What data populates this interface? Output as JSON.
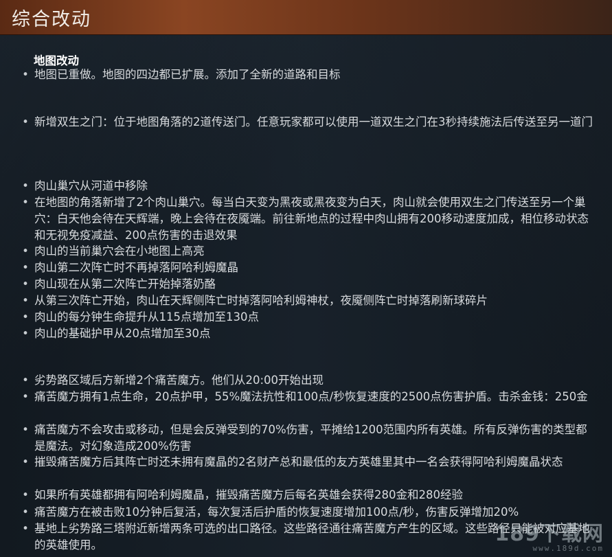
{
  "header": {
    "title": "综合改动"
  },
  "section": {
    "title": "地图改动"
  },
  "bullets": [
    {
      "text": "地图已重做。地图的四边都已扩展。添加了全新的道路和目标"
    },
    {
      "text": "新增双生之门：位于地图角落的2道传送门。任意玩家都可以使用一道双生之门在3秒持续施法后传送至另一道门"
    },
    {
      "text": "肉山巢穴从河道中移除"
    },
    {
      "text": "在地图的角落新增了2个肉山巢穴。每当白天变为黑夜或黑夜变为白天，肉山就会使用双生之门传送至另一个巢穴：白天他会待在天辉端，晚上会待在夜魇端。前往新地点的过程中肉山拥有200移动速度加成，相位移动状态和无视免疫减益、200点伤害的击退效果"
    },
    {
      "text": "肉山的当前巢穴会在小地图上高亮"
    },
    {
      "text": "肉山第二次阵亡时不再掉落阿哈利姆魔晶"
    },
    {
      "text": "肉山现在从第二次阵亡开始掉落奶酪"
    },
    {
      "text": "从第三次阵亡开始，肉山在天辉侧阵亡时掉落阿哈利姆神杖，夜魇侧阵亡时掉落刷新球碎片"
    },
    {
      "text": "肉山的每分钟生命提升从115点增加至130点"
    },
    {
      "text": "肉山的基础护甲从20点增加至30点"
    },
    {
      "text": "劣势路区域后方新增2个痛苦魔方。他们从20:00开始出现"
    },
    {
      "text": "痛苦魔方拥有1点生命，20点护甲，55%魔法抗性和100点/秒恢复速度的2500点伤害护盾。击杀金钱：250金"
    },
    {
      "text": "痛苦魔方不会攻击或移动，但是会反弹受到的70%伤害，平摊给1200范围内所有英雄。所有反弹伤害的类型都是魔法。对幻象造成200%伤害"
    },
    {
      "text": "摧毁痛苦魔方后其阵亡时还未拥有魔晶的2名财产总和最低的友方英雄里其中一名会获得阿哈利姆魔晶状态"
    },
    {
      "text": "如果所有英雄都拥有阿哈利姆魔晶，摧毁痛苦魔方后每名英雄会获得280金和280经验"
    },
    {
      "text": "痛苦魔方在被击败10分钟后复活，每次复活后护盾的恢复速度增加100点/秒，伤害反弹增加20%"
    },
    {
      "text": "基地上劣势路三塔附近新增两条可选的出口路径。这些路径通往痛苦魔方产生的区域。这些路径只能被对应基地的英雄使用。"
    }
  ],
  "watermark": {
    "main": "189下载网",
    "sub": "www.189d.com"
  }
}
